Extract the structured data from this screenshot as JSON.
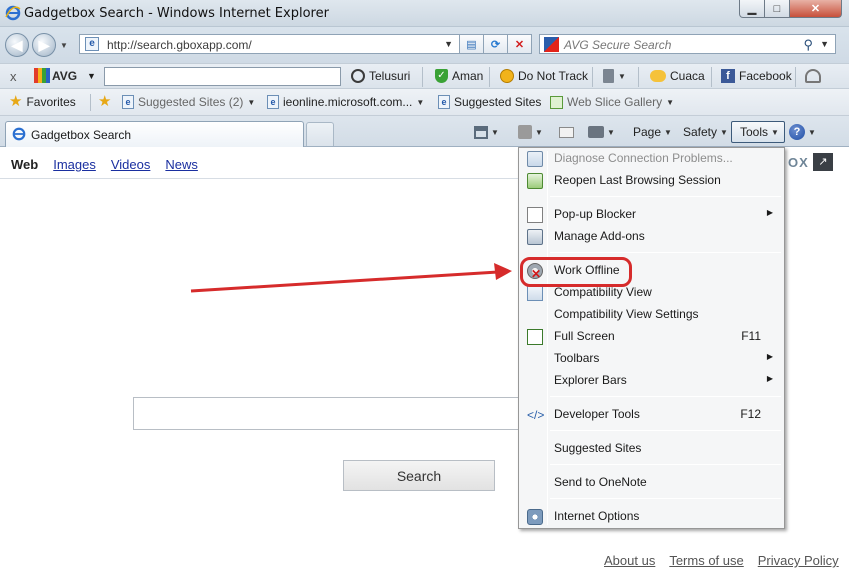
{
  "window": {
    "title": "Gadgetbox Search - Windows Internet Explorer",
    "controls": {
      "minimize": "▁",
      "maximize": "□",
      "close": "✕"
    }
  },
  "address_bar": {
    "url": "http://search.gboxapp.com/",
    "back_icon": "back-arrow-icon",
    "forward_icon": "forward-arrow-icon"
  },
  "search_box": {
    "placeholder": "AVG Secure Search"
  },
  "avg_toolbar": {
    "close": "x",
    "brand": "AVG",
    "items": {
      "search": "Telusuri",
      "safe": "Aman",
      "dnt": "Do Not Track",
      "weather": "Cuaca",
      "facebook": "Facebook"
    }
  },
  "favorites_bar": {
    "favorites": "Favorites",
    "items": [
      "Suggested Sites (2)",
      "ieonline.microsoft.com...",
      "Suggested Sites",
      "Web Slice Gallery"
    ]
  },
  "tabs": {
    "active_title": "Gadgetbox Search"
  },
  "command_bar": {
    "page": "Page",
    "safety": "Safety",
    "tools": "Tools"
  },
  "page": {
    "nav": {
      "web": "Web",
      "images": "Images",
      "videos": "Videos",
      "news": "News"
    },
    "brand_fragment": "OX",
    "search_button": "Search",
    "footer": {
      "about": "About us",
      "terms": "Terms of use",
      "privacy": "Privacy Policy"
    }
  },
  "tools_menu": {
    "items": [
      {
        "label": "Diagnose Connection Problems...",
        "disabled": true,
        "icon": "diagnose-icon"
      },
      {
        "label": "Reopen Last Browsing Session",
        "icon": "reopen-session-icon"
      },
      {
        "label": "Pop-up Blocker",
        "submenu": true,
        "icon": "popup-blocker-icon"
      },
      {
        "label": "Manage Add-ons",
        "icon": "manage-addons-icon"
      },
      {
        "label": "Work Offline",
        "icon": "work-offline-icon",
        "highlighted": true
      },
      {
        "label": "Compatibility View",
        "icon": "compatibility-view-icon"
      },
      {
        "label": "Compatibility View Settings"
      },
      {
        "label": "Full Screen",
        "shortcut": "F11",
        "icon": "full-screen-icon"
      },
      {
        "label": "Toolbars",
        "submenu": true
      },
      {
        "label": "Explorer Bars",
        "submenu": true
      },
      {
        "label": "Developer Tools",
        "shortcut": "F12",
        "icon": "developer-tools-icon"
      },
      {
        "label": "Suggested Sites"
      },
      {
        "label": "Send to OneNote"
      },
      {
        "label": "Internet Options",
        "icon": "internet-options-icon"
      }
    ]
  },
  "annotation": {
    "arrow_color": "#d62b2b",
    "circle_color": "#d62b2b"
  }
}
